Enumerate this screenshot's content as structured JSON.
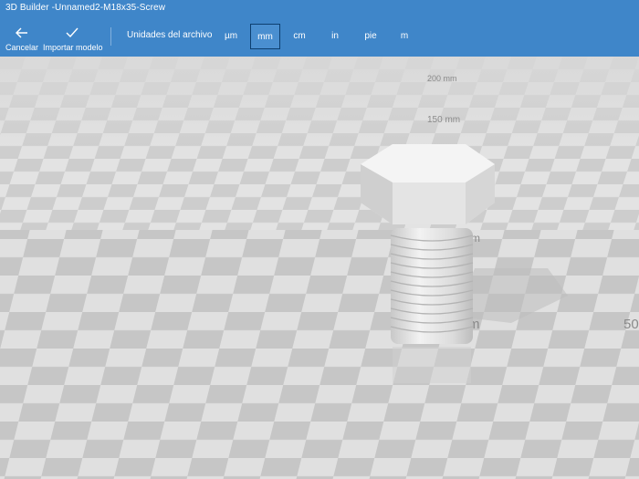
{
  "window": {
    "title": "3D Builder -Unnamed2-M18x35-Screw"
  },
  "toolbar": {
    "cancel_label": "Cancelar",
    "import_label": "Importar modelo",
    "units_label": "Unidades del archivo",
    "units": [
      "µm",
      "mm",
      "cm",
      "in",
      "pie",
      "m"
    ],
    "selected_unit": "mm"
  },
  "viewport": {
    "scale_labels": [
      "200 mm",
      "150 mm",
      "mm",
      "m",
      "50"
    ]
  },
  "colors": {
    "toolbar": "#3f86c9",
    "floor_light": "#e3e3e3",
    "floor_dark": "#c9c9c9",
    "model": "#ececec"
  }
}
